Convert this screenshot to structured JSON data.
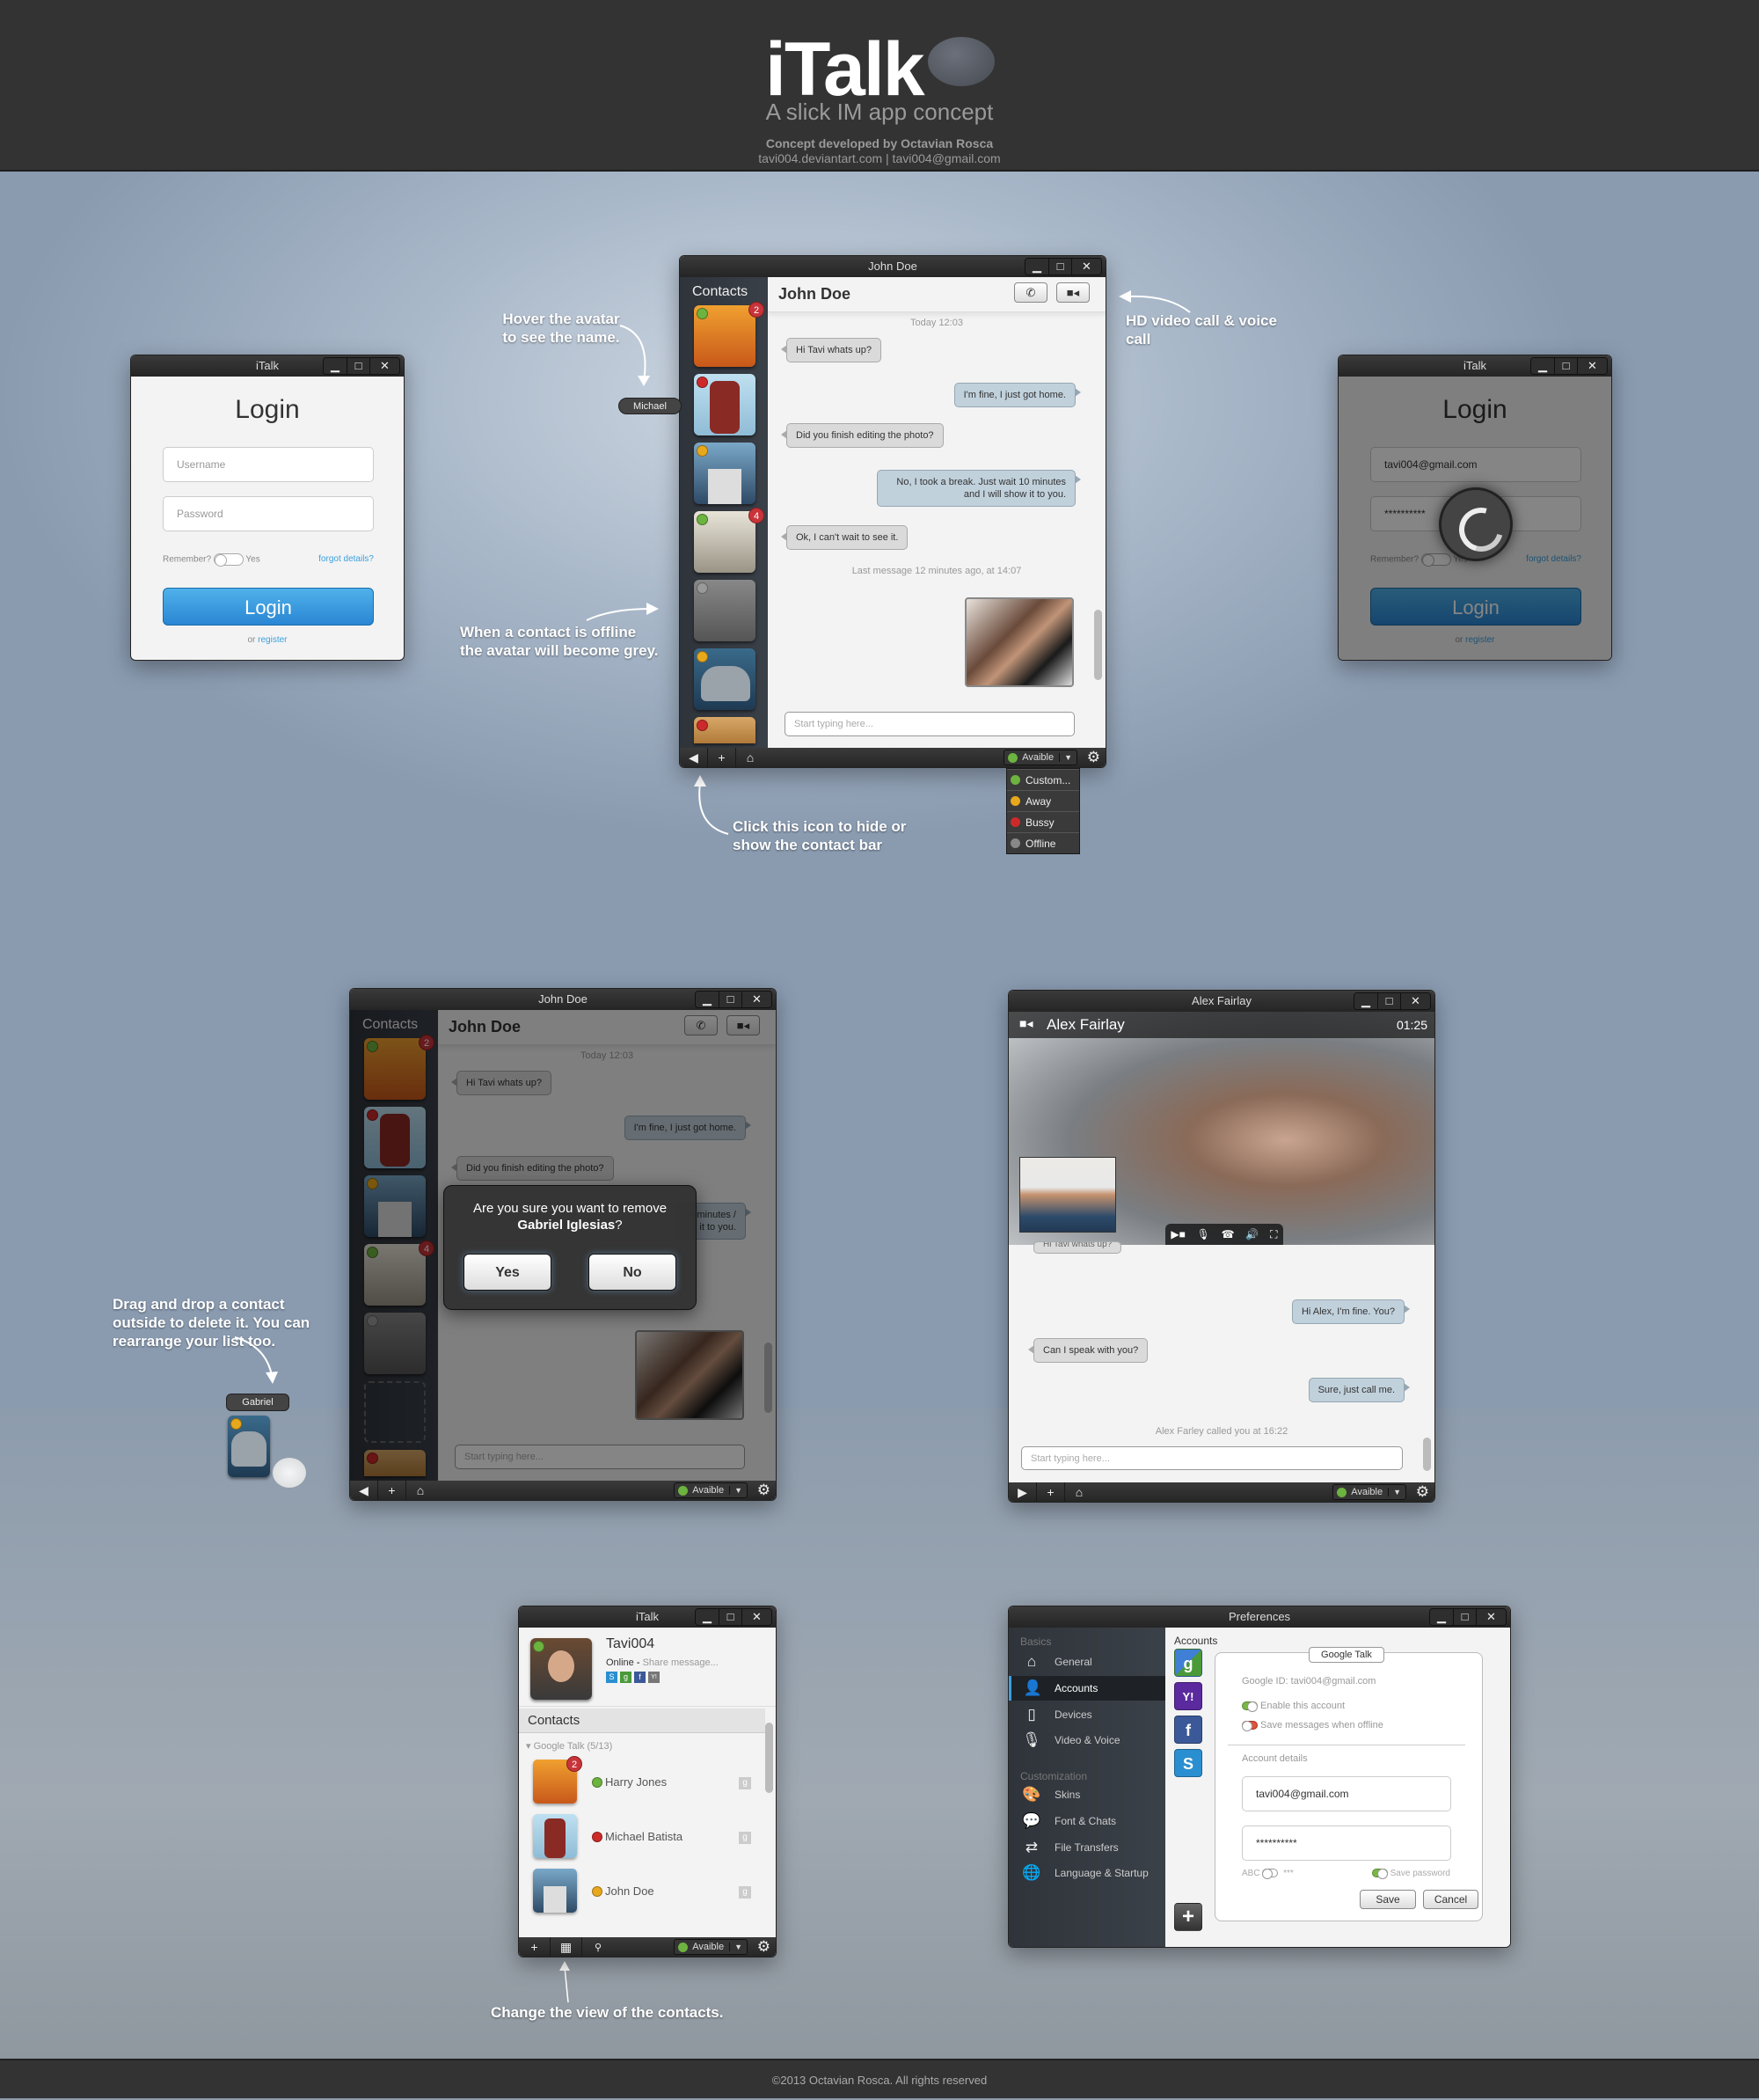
{
  "header": {
    "logo": "iTalk",
    "tagline": "A slick IM app concept",
    "credit": "Concept developed by Octavian Rosca",
    "contact": "tavi004.deviantart.com | tavi004@gmail.com"
  },
  "footer": {
    "copyright": "©2013 Octavian Rosca. All rights reserved"
  },
  "annotations": {
    "hover_avatar": "Hover the avatar to see the name.",
    "offline_grey": "When a contact is offline the avatar will become grey.",
    "hd_call": "HD video call & voice call",
    "toggle_bar": "Click this icon to hide or show the contact bar",
    "drag_drop": "Drag and drop a contact outside to delete it. You can rearrange your list too.",
    "change_view": "Change the view of the contacts."
  },
  "window_controls": {
    "minimize": "▁",
    "maximize": "□",
    "close": "✕"
  },
  "login_window": {
    "title": "iTalk",
    "heading": "Login",
    "username_placeholder": "Username",
    "password_placeholder": "Password",
    "remember_label": "Remember?",
    "remember_yes": "Yes",
    "forgot_link": "forgot details?",
    "login_button": "Login",
    "or_text": "or",
    "register_link": "register"
  },
  "login_loading_window": {
    "title": "iTalk",
    "heading": "Login",
    "username_value": "tavi004@gmail.com",
    "password_value": "**********",
    "remember_label": "Remember?",
    "remember_yes": "Yes",
    "forgot_link": "forgot details?",
    "login_button": "Login",
    "or_text": "or",
    "register_link": "register"
  },
  "chat_window": {
    "title": "John Doe",
    "sidebar_title": "Contacts",
    "contact_name": "John Doe",
    "hover_tooltip": "Michael",
    "contacts": [
      {
        "status": "online",
        "badge": "2",
        "color": "#e07a1e"
      },
      {
        "status": "busy",
        "badge": "",
        "color": "#a7d2e8"
      },
      {
        "status": "away",
        "badge": "",
        "color": "#5a7f9e"
      },
      {
        "status": "online",
        "badge": "4",
        "color": "#c9c4b6"
      },
      {
        "status": "offline",
        "badge": "",
        "color": "#777777"
      },
      {
        "status": "away",
        "badge": "",
        "color": "#2e5a78"
      },
      {
        "status": "busy",
        "badge": "",
        "color": "#c89a5a"
      }
    ],
    "day_stamp": "Today 12:03",
    "messages": [
      {
        "dir": "in",
        "text": "Hi Tavi whats up?"
      },
      {
        "dir": "out",
        "text": "I'm fine, I just got home."
      },
      {
        "dir": "in",
        "text": "Did you finish editing the photo?"
      },
      {
        "dir": "out",
        "text": "No, I took a break. Just wait 10 minutes and I will show it to you."
      },
      {
        "dir": "in",
        "text": "Ok, I can't wait to see it."
      }
    ],
    "last_message": "Last message 12 minutes ago, at 14:07",
    "input_placeholder": "Start typing here...",
    "status": "Avaible",
    "status_menu": [
      {
        "label": "Custom...",
        "color": "#6db33f"
      },
      {
        "label": "Away",
        "color": "#e8a81c"
      },
      {
        "label": "Bussy",
        "color": "#cc2a2a"
      },
      {
        "label": "Offline",
        "color": "#888888"
      }
    ]
  },
  "remove_window": {
    "title": "John Doe",
    "sidebar_title": "Contacts",
    "contact_name": "John Doe",
    "day_stamp": "Today 12:03",
    "messages": [
      {
        "dir": "in",
        "text": "Hi Tavi whats up?"
      },
      {
        "dir": "out",
        "text": "I'm fine, I just got home."
      },
      {
        "dir": "in",
        "text": "Did you finish editing the photo?"
      },
      {
        "dir": "out",
        "text": "0 minutes / it to you."
      }
    ],
    "dialog_question": "Are you sure you want to remove",
    "dialog_name": "Gabriel Iglesias",
    "dialog_qmark": "?",
    "yes_button": "Yes",
    "no_button": "No",
    "input_placeholder": "Start typing here...",
    "status": "Avaible",
    "dragged_contact": "Gabriel"
  },
  "video_window": {
    "title": "Alex Fairlay",
    "caller_name": "Alex Fairlay",
    "duration": "01:25",
    "messages": [
      {
        "dir": "in",
        "text": "Hi Tavi whats up?"
      },
      {
        "dir": "out",
        "text": "Hi Alex, I'm fine. You?"
      },
      {
        "dir": "in",
        "text": "Can I speak with you?"
      },
      {
        "dir": "out",
        "text": "Sure, just call me."
      }
    ],
    "call_notice": "Alex Farley called you at 16:22",
    "input_placeholder": "Start typing here...",
    "status": "Avaible"
  },
  "contacts_window": {
    "title": "iTalk",
    "username": "Tavi004",
    "presence": "Online",
    "share_placeholder": "Share message...",
    "networks": [
      "S",
      "g",
      "f",
      "Y!"
    ],
    "contacts_heading": "Contacts",
    "group": "Google Talk (5/13)",
    "contacts": [
      {
        "name": "Harry Jones",
        "status_color": "#6db33f",
        "badge": "2",
        "avatar_color": "#e07a1e"
      },
      {
        "name": "Michael Batista",
        "status_color": "#cc2a2a",
        "badge": "",
        "avatar_color": "#a7d2e8"
      },
      {
        "name": "John Doe",
        "status_color": "#e8a81c",
        "badge": "",
        "avatar_color": "#5a7f9e"
      }
    ],
    "status": "Avaible"
  },
  "preferences_window": {
    "title": "Preferences",
    "sections": [
      {
        "heading": "Basics",
        "items": [
          {
            "label": "General",
            "icon": "⌂"
          },
          {
            "label": "Accounts",
            "icon": "👤",
            "active": true
          },
          {
            "label": "Devices",
            "icon": "▯"
          },
          {
            "label": "Video & Voice",
            "icon": "🎙"
          }
        ]
      },
      {
        "heading": "Customization",
        "items": [
          {
            "label": "Skins",
            "icon": "🎨"
          },
          {
            "label": "Font & Chats",
            "icon": "💬"
          },
          {
            "label": "File Transfers",
            "icon": "⇄"
          },
          {
            "label": "Language & Startup",
            "icon": "🌐"
          }
        ]
      }
    ],
    "accounts_heading": "Accounts",
    "account_tabs": [
      {
        "name": "Google",
        "glyph": "g",
        "color": "#3f7fd6"
      },
      {
        "name": "Yahoo",
        "glyph": "Y!",
        "color": "#5a2a9e"
      },
      {
        "name": "Facebook",
        "glyph": "f",
        "color": "#3b5998"
      },
      {
        "name": "Skype",
        "glyph": "S",
        "color": "#2a8fd0"
      }
    ],
    "panel_title": "Google Talk",
    "google_id": "Google ID: tavi004@gmail.com",
    "enable_account": "Enable this account",
    "save_offline": "Save messages when offline",
    "account_details": "Account details",
    "email_value": "tavi004@gmail.com",
    "password_value": "**********",
    "abc_label": "ABC",
    "mask_label": "***",
    "save_password": "Save password",
    "save_button": "Save",
    "cancel_button": "Cancel"
  }
}
